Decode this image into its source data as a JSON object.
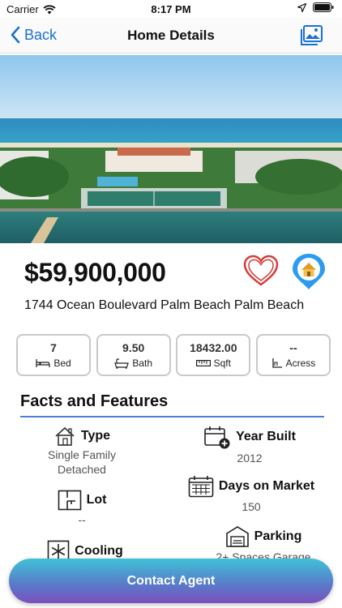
{
  "status_bar": {
    "carrier": "Carrier",
    "time": "8:17 PM",
    "icons": [
      "wifi-icon",
      "location-arrow-icon",
      "battery-icon"
    ]
  },
  "nav": {
    "back_label": "Back",
    "title": "Home Details",
    "right_icon": "gallery-icon"
  },
  "listing": {
    "price": "$59,900,000",
    "address": "1744 Ocean Boulevard Palm Beach Palm Beach",
    "favorite_icon": "heart-icon",
    "map_icon": "home-pin-icon"
  },
  "stats": [
    {
      "value": "7",
      "label": "Bed",
      "icon": "bed-icon"
    },
    {
      "value": "9.50",
      "label": "Bath",
      "icon": "bathtub-icon"
    },
    {
      "value": "18432.00",
      "label": "Sqft",
      "icon": "ruler-icon"
    },
    {
      "value": "--",
      "label": "Acress",
      "icon": "area-icon"
    }
  ],
  "facts": {
    "title": "Facts and Features",
    "type": {
      "label": "Type",
      "value": "Single Family Detached",
      "icon": "house-icon"
    },
    "year_built": {
      "label": "Year Built",
      "value": "2012",
      "icon": "calendar-plus-icon"
    },
    "lot": {
      "label": "Lot",
      "value": "--",
      "icon": "floorplan-icon"
    },
    "days_on_market": {
      "label": "Days on Market",
      "value": "150",
      "icon": "calendar-grid-icon"
    },
    "cooling": {
      "label": "Cooling",
      "value": "",
      "icon": "snowflake-icon"
    },
    "parking": {
      "label": "Parking",
      "value": "2+ Spaces Garage",
      "icon": "garage-icon"
    }
  },
  "contact_button": {
    "label": "Contact Agent"
  },
  "colors": {
    "accent": "#1a6fd8",
    "heart": "#d83a3a",
    "pin": "#2b9bf0",
    "section_line": "#4a7fd6"
  }
}
